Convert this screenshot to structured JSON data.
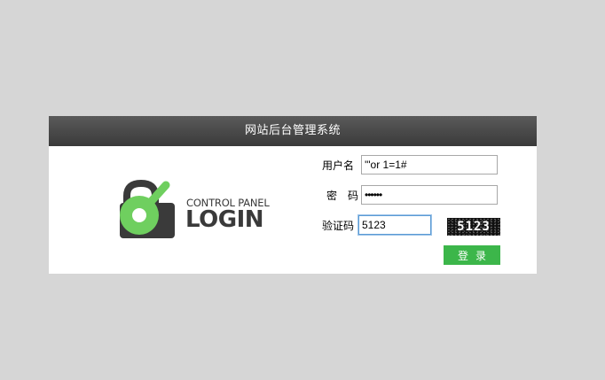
{
  "panel": {
    "title": "网站后台管理系统"
  },
  "logo": {
    "line1": "CONTROL PANEL",
    "line2": "LOGIN"
  },
  "form": {
    "username_label": "用户名",
    "username_value": "'\"or 1=1#",
    "password_label": "密　码",
    "password_value": "••••••",
    "captcha_label": "验证码",
    "captcha_value": "5123",
    "captcha_image_text": "5123",
    "submit_label": "登录"
  },
  "colors": {
    "background": "#d6d6d6",
    "header": "#444444",
    "accent_green": "#3cb64a",
    "logo_green": "#6fcf5f",
    "logo_dark": "#3a3a3a"
  },
  "icons": {
    "logo_mark": "padlock-key-icon"
  }
}
